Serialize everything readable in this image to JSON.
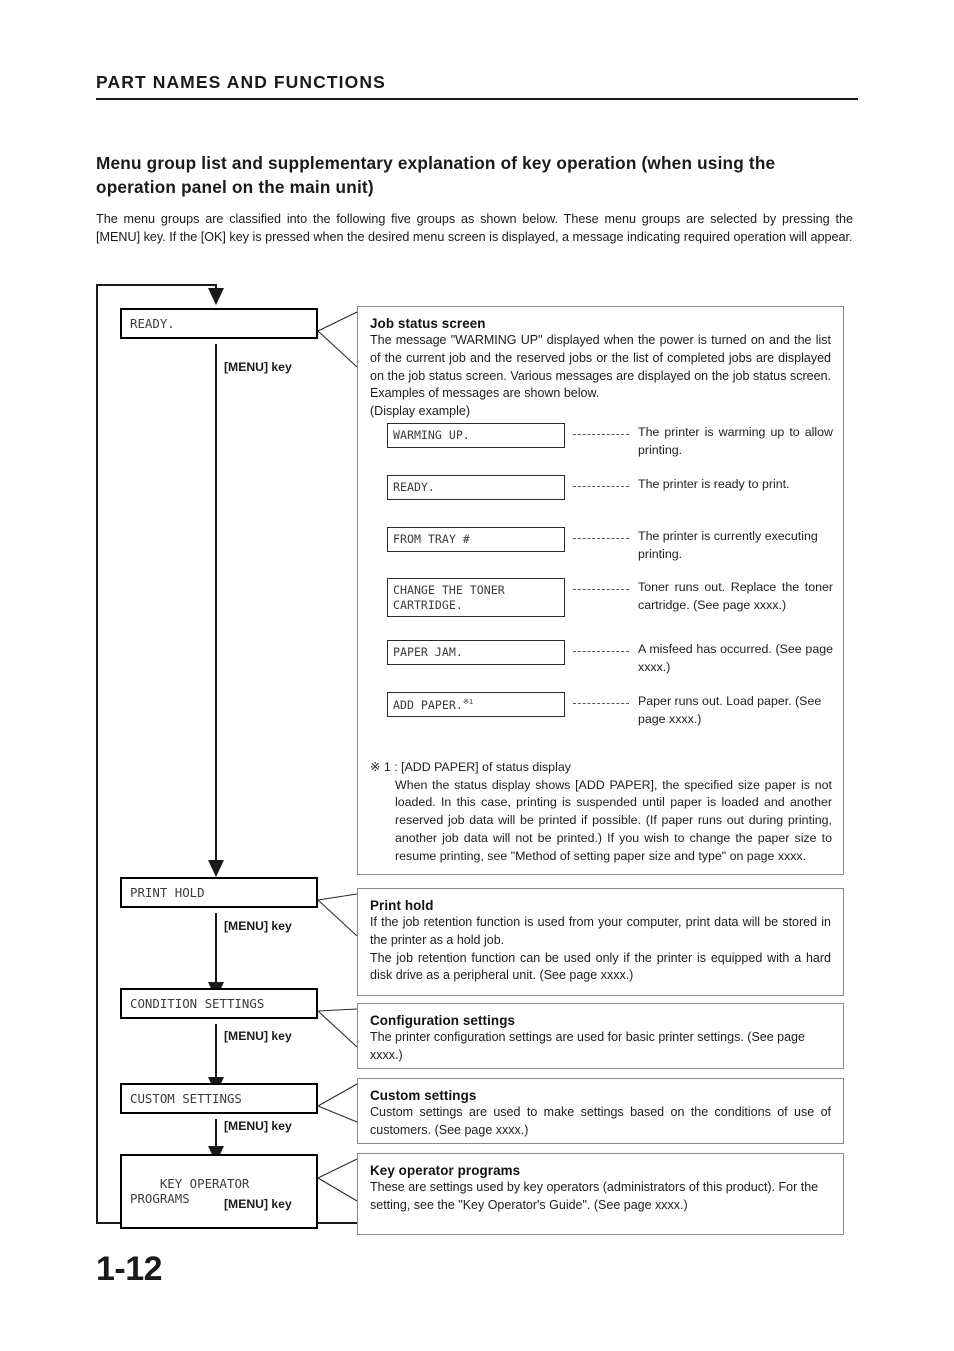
{
  "header": {
    "running_head": "PART NAMES AND FUNCTIONS"
  },
  "section": {
    "heading": "Menu group list and supplementary explanation of key operation (when using the operation panel on the main unit)",
    "intro": "The menu groups are classified into the following five groups as shown below. These menu groups are selected by pressing the [MENU] key. If the [OK] key is pressed when the desired menu screen is displayed, a message indicating required operation will appear."
  },
  "flow": {
    "menu_key_label": "[MENU] key",
    "boxes": [
      {
        "label": "READY."
      },
      {
        "label": "PRINT HOLD"
      },
      {
        "label": "CONDITION SETTINGS"
      },
      {
        "label": "CUSTOM SETTINGS"
      },
      {
        "label": "KEY OPERATOR\nPROGRAMS"
      }
    ]
  },
  "panels": {
    "job_status": {
      "title": "Job status screen",
      "body": "The message \"WARMING UP\" displayed when the power is turned on and the list of the current job and the reserved jobs or the list of completed jobs are displayed on the job status screen. Various messages are displayed on the job status screen. Examples of messages are shown below.",
      "display_example_label": "(Display example)",
      "messages": [
        {
          "text": "WARMING UP.",
          "sup": "",
          "desc": "The printer is warming up to allow printing."
        },
        {
          "text": "READY.",
          "sup": "",
          "desc": "The printer is ready to print."
        },
        {
          "text": "FROM TRAY #",
          "sup": "",
          "desc": "The printer is currently executing printing."
        },
        {
          "text": "CHANGE THE TONER\nCARTRIDGE.",
          "sup": "",
          "desc": "Toner runs out. Replace the toner cartridge. (See page xxxx.)"
        },
        {
          "text": "PAPER JAM.",
          "sup": "",
          "desc": "A misfeed has occurred. (See page xxxx.)"
        },
        {
          "text": "ADD PAPER.",
          "sup": "※1",
          "desc": "Paper runs out. Load paper. (See page xxxx.)"
        }
      ],
      "footnote_head": "※ 1 : [ADD PAPER] of status display",
      "footnote_body": "When the status display shows [ADD PAPER], the specified size paper is not loaded. In this case, printing is suspended until paper is loaded and another reserved job data will be printed if possible. (If paper runs out during printing, another job data will not be printed.) If you wish to change the paper size to resume printing, see \"Method of setting paper size and type\" on page xxxx."
    },
    "print_hold": {
      "title": "Print hold",
      "body": "If the job retention function is used from your computer, print data will be stored in the printer as a hold job.\nThe job retention function can be used only if the printer is equipped with a hard disk drive as a peripheral unit. (See page xxxx.)"
    },
    "configuration_settings": {
      "title": "Configuration settings",
      "body": "The printer configuration settings are used for basic printer settings. (See page xxxx.)"
    },
    "custom_settings": {
      "title": "Custom settings",
      "body": "Custom settings are used to make settings based on the conditions of use of customers. (See page xxxx.)"
    },
    "key_operator_programs": {
      "title": "Key operator programs",
      "body": "These are settings used by key operators (administrators of this product). For the setting, see the \"Key Operator's Guide\". (See page xxxx.)"
    }
  },
  "footer": {
    "page_number": "1-12"
  }
}
